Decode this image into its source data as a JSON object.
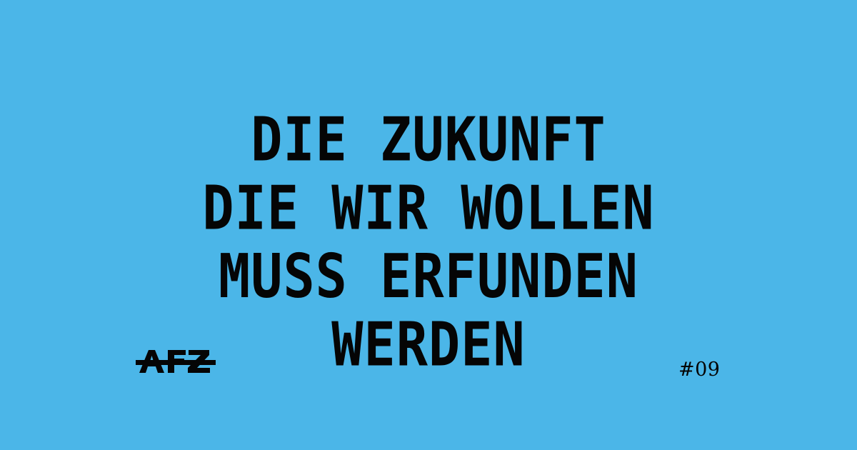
{
  "page": {
    "background_color": "#4bb6e8",
    "text_color": "#050505"
  },
  "headline": {
    "lines": [
      "DIE ZUKUNFT",
      "DIE WIR WOLLEN",
      "MUSS ERFUNDEN",
      "WERDEN"
    ]
  },
  "brand": {
    "logo_text": "AFZ",
    "logo_icon": "afz-logo-icon"
  },
  "issue": {
    "number": "#09"
  }
}
